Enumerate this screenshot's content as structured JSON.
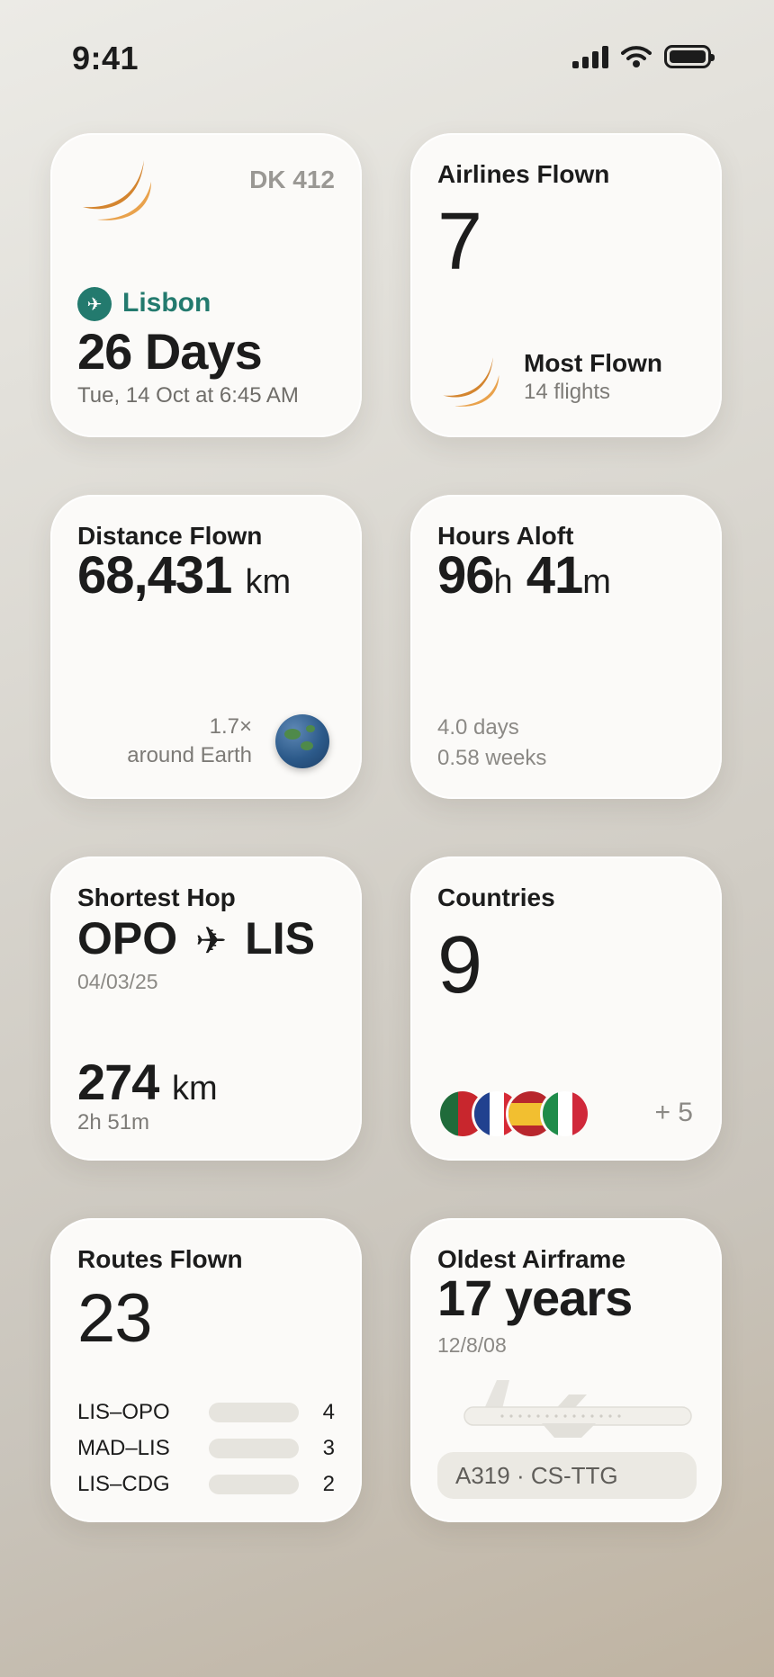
{
  "status_bar": {
    "time": "9:41"
  },
  "next_flight": {
    "flight_number": "DK 412",
    "destination": "Lisbon",
    "countdown": "26 Days",
    "departure": "Tue, 14 Oct at 6:45 AM"
  },
  "airlines": {
    "title": "Airlines Flown",
    "count": "7",
    "most_flown_label": "Most Flown",
    "most_flown_flights": "14 flights"
  },
  "distance": {
    "title": "Distance Flown",
    "value": "68,431",
    "unit": "km",
    "earth_multiple": "1.7×",
    "earth_label": "around Earth"
  },
  "hours": {
    "title": "Hours Aloft",
    "hours": "96",
    "hours_unit": "h",
    "minutes": "41",
    "minutes_unit": "m",
    "days": "4.0 days",
    "weeks": "0.58 weeks"
  },
  "shortest_hop": {
    "title": "Shortest Hop",
    "origin": "OPO",
    "destination": "LIS",
    "date": "04/03/25",
    "distance": "274",
    "unit": "km",
    "duration": "2h 51m"
  },
  "countries": {
    "title": "Countries",
    "count": "9",
    "more": "+ 5",
    "flag_icons": [
      "portugal-flag-icon",
      "france-flag-icon",
      "spain-flag-icon",
      "italy-flag-icon"
    ]
  },
  "routes": {
    "title": "Routes Flown",
    "count": "23",
    "top": [
      {
        "name": "LIS–OPO",
        "count": "4"
      },
      {
        "name": "MAD–LIS",
        "count": "3"
      },
      {
        "name": "LIS–CDG",
        "count": "2"
      }
    ]
  },
  "airframe": {
    "title": "Oldest Airframe",
    "age": "17 years",
    "date": "12/8/08",
    "registration": "A319 · CS-TTG"
  },
  "colors": {
    "accent_teal": "#237a6e",
    "airline_orange": "#d4852f"
  }
}
